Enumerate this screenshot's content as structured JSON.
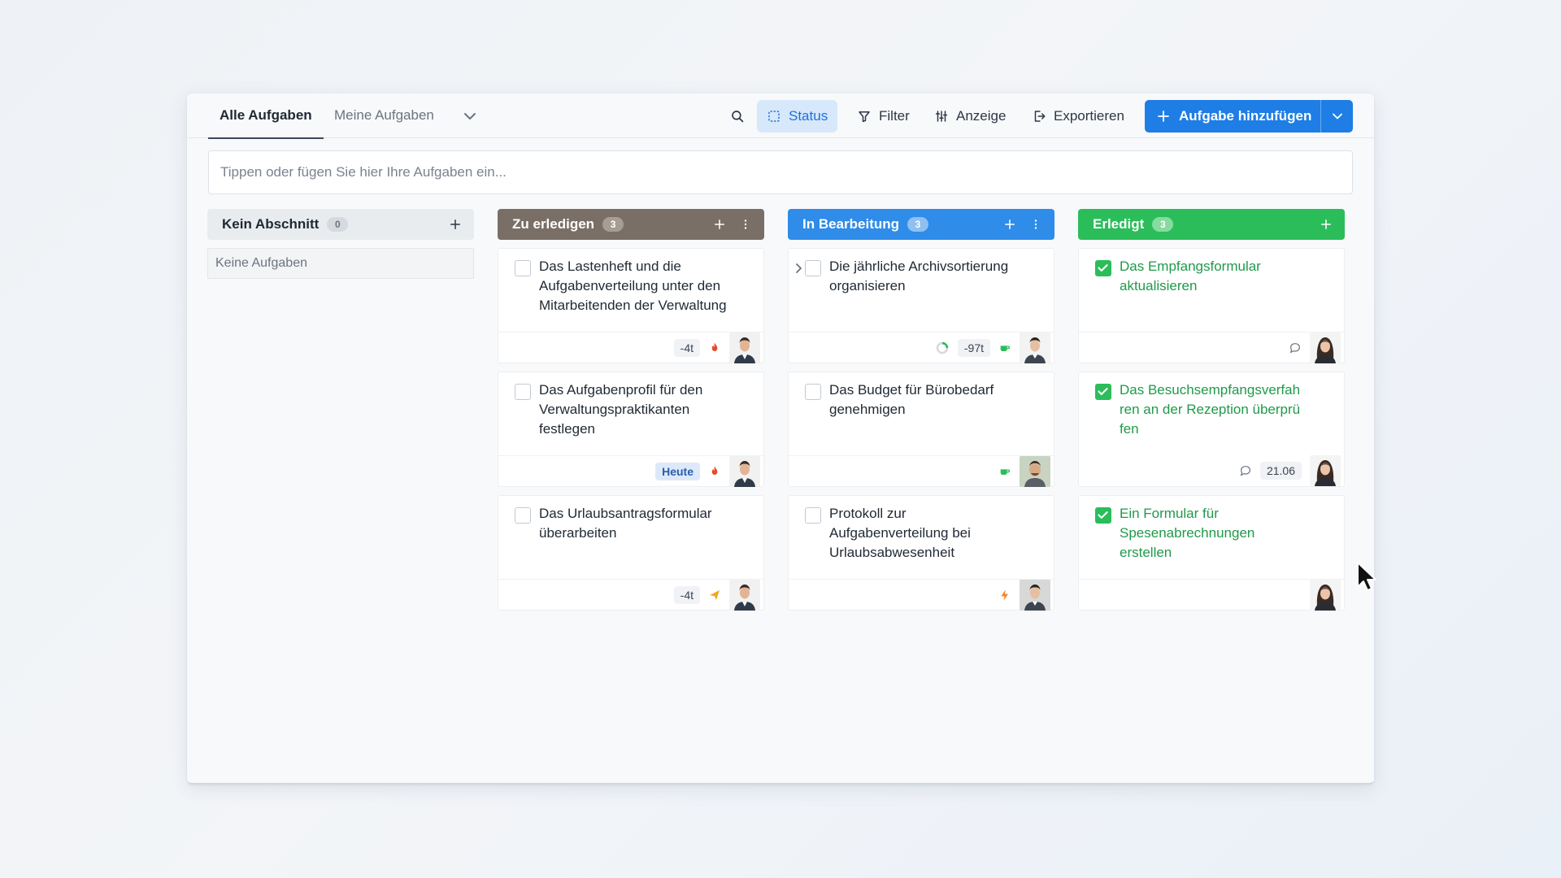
{
  "tabs": [
    {
      "label": "Alle Aufgaben",
      "active": true
    },
    {
      "label": "Meine Aufgaben",
      "active": false
    }
  ],
  "toolbar": {
    "status": "Status",
    "filter": "Filter",
    "display": "Anzeige",
    "export": "Exportieren",
    "add_task": "Aufgabe hinzufügen"
  },
  "quick_input": {
    "placeholder": "Tippen oder fügen Sie hier Ihre Aufgaben ein...",
    "value": ""
  },
  "columns": [
    {
      "title": "Kein Abschnitt",
      "count": "0",
      "color": "#e9ecef",
      "empty_text": "Keine Aufgaben"
    },
    {
      "title": "Zu erledigen",
      "count": "3",
      "color": "#7a6f66",
      "cards": [
        {
          "title": "Das Lastenheft und die Aufgabenverteilung unter den Mitarbeitenden der Verwaltung",
          "badge": "-4t",
          "priority_icon": "fire-icon",
          "avatar": "male-avatar"
        },
        {
          "title": "Das Aufgabenprofil für den Verwaltungspraktikanten festlegen",
          "badge": "Heute",
          "priority_icon": "fire-icon",
          "avatar": "male-avatar"
        },
        {
          "title": "Das Urlaubsantragsformular überarbeiten",
          "badge": "-4t",
          "priority_icon": "send-icon",
          "avatar": "male-avatar"
        }
      ]
    },
    {
      "title": "In Bearbeitung",
      "count": "3",
      "color": "#2f8ce8",
      "cards": [
        {
          "title": "Die jährliche Archivsortierung organisieren",
          "badge": "-97t",
          "priority_icon": "coffee-icon",
          "avatar": "male-avatar-2",
          "progress_icon": "progress-ring-icon",
          "expandable": true
        },
        {
          "title": "Das Budget für Bürobedarf genehmigen",
          "priority_icon": "coffee-icon",
          "avatar": "male-avatar-3"
        },
        {
          "title": "Protokoll zur Aufgabenverteilung bei Urlaubsabwesenheit",
          "priority_icon": "bolt-icon",
          "avatar": "male-avatar-2"
        }
      ]
    },
    {
      "title": "Erledigt",
      "count": "3",
      "color": "#2bbd5a",
      "cards": [
        {
          "title": "Das Empfangsformular aktualisieren",
          "comment_icon": true,
          "avatar": "female-avatar"
        },
        {
          "title": "Das Besuchsempfangsverfahren an der Rezeption überprüfen",
          "comment_icon": true,
          "badge": "21.06",
          "avatar": "female-avatar"
        },
        {
          "title": "Ein Formular für Spesenabrechnungen erstellen",
          "avatar": "female-avatar"
        }
      ]
    }
  ]
}
